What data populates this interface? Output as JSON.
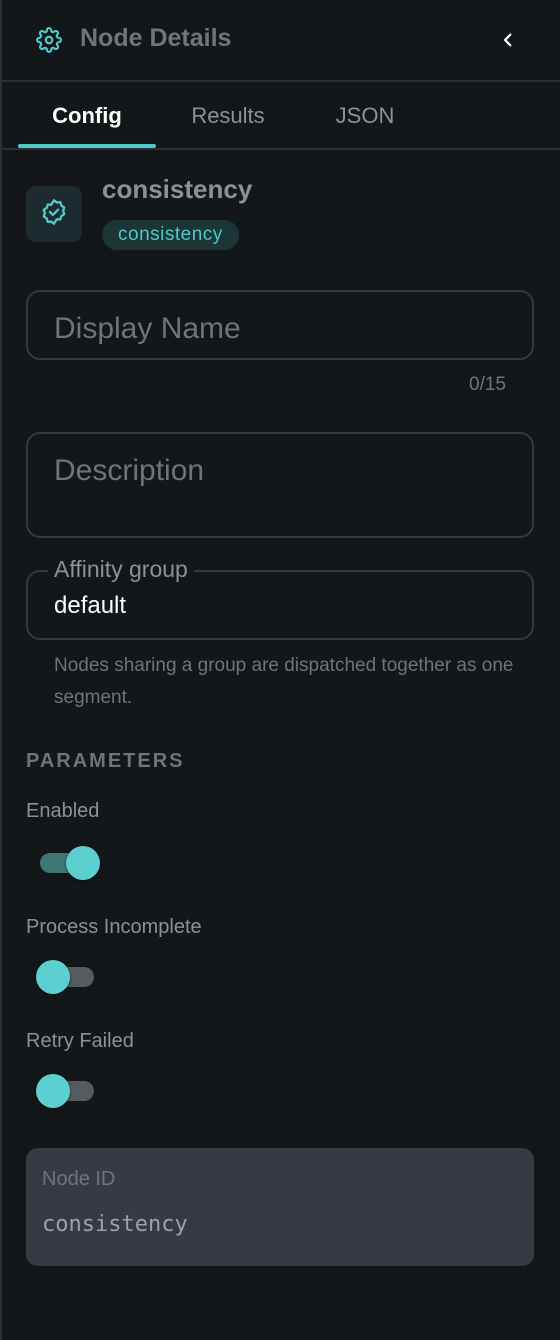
{
  "header": {
    "title": "Node Details",
    "icon": "gear-icon",
    "collapse_icon": "chevron-left-icon"
  },
  "tabs": [
    {
      "label": "Config",
      "active": true
    },
    {
      "label": "Results",
      "active": false
    },
    {
      "label": "JSON",
      "active": false
    }
  ],
  "node": {
    "name": "consistency",
    "type_badge": "consistency",
    "icon": "verified-badge-icon"
  },
  "form": {
    "display_name": {
      "placeholder": "Display Name",
      "value": "",
      "counter": "0/15"
    },
    "description": {
      "placeholder": "Description",
      "value": ""
    },
    "affinity_group": {
      "label": "Affinity group",
      "value": "default",
      "helper": "Nodes sharing a group are dispatched together as one segment."
    }
  },
  "parameters": {
    "title": "PARAMETERS",
    "items": [
      {
        "label": "Enabled",
        "on": true
      },
      {
        "label": "Process Incomplete",
        "on": false
      },
      {
        "label": "Retry Failed",
        "on": false
      }
    ]
  },
  "node_id": {
    "label": "Node ID",
    "value": "consistency"
  },
  "colors": {
    "accent": "#4fc9ca",
    "background": "#131719",
    "badge_bg": "#1c3536",
    "nodeid_bg": "#363b41"
  }
}
